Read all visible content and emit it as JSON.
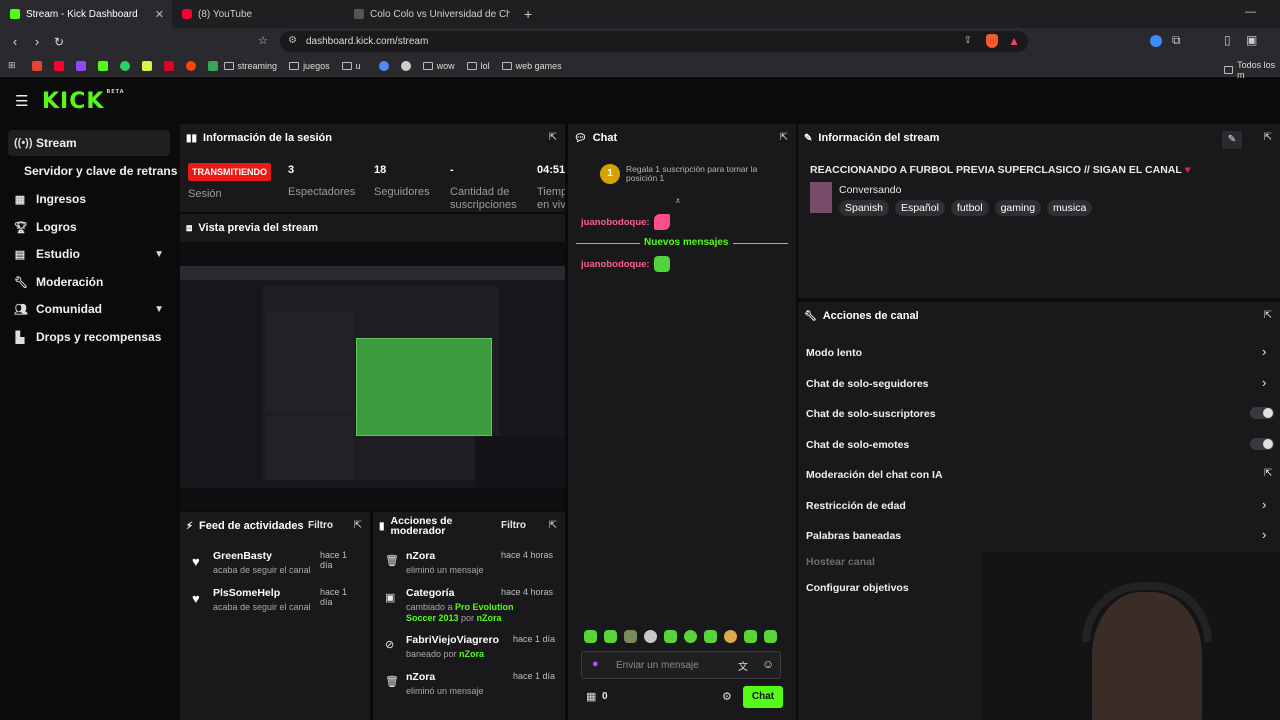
{
  "browser": {
    "tabs": [
      {
        "title": "Stream - Kick Dashboard",
        "color": "#53fc18"
      },
      {
        "title": "(8) YouTube",
        "color": "#ff0033"
      },
      {
        "title": "Colo Colo vs Universidad de Chile Al",
        "color": "#444444"
      }
    ],
    "new_tab": "+",
    "url": "dashboard.kick.com/stream",
    "bookmarks": {
      "folders": [
        "streaming",
        "juegos",
        "u",
        "wow",
        "lol",
        "web games"
      ],
      "right_folder": "Todos los m"
    }
  },
  "app": {
    "logo": "KICK",
    "logo_badge": "BETA",
    "accent": "#53fc18",
    "sidebar": [
      {
        "label": "Stream",
        "icon": "broadcast-icon"
      },
      {
        "label": "Servidor y clave de retransmisión",
        "icon": ""
      },
      {
        "label": "Ingresos",
        "icon": "money-icon"
      },
      {
        "label": "Logros",
        "icon": "trophy-icon"
      },
      {
        "label": "Estudio",
        "icon": "studio-icon"
      },
      {
        "label": "Moderación",
        "icon": "wrench-icon"
      },
      {
        "label": "Comunidad",
        "icon": "community-icon"
      },
      {
        "label": "Drops y recompensas",
        "icon": "drops-icon"
      }
    ]
  },
  "session": {
    "title": "Información de la sesión",
    "status": "TRANSMITIENDO",
    "status_label": "Sesión",
    "stats": [
      {
        "value": "3",
        "label": "Espectadores"
      },
      {
        "value": "18",
        "label": "Seguidores"
      },
      {
        "value": "-",
        "label": "Cantidad de suscripciones"
      },
      {
        "value": "04:51",
        "label": "Tiempo en vivo"
      }
    ]
  },
  "preview": {
    "title": "Vista previa del stream"
  },
  "feed": {
    "title": "Feed de actividades",
    "filter": "Filtro",
    "items": [
      {
        "name": "GreenBasty",
        "text": "acaba de seguir el canal",
        "time": "hace 1 día"
      },
      {
        "name": "PlsSomeHelp",
        "text": "acaba de seguir el canal",
        "time": "hace 1 día"
      }
    ]
  },
  "mod_actions": {
    "title": "Acciones de moderador",
    "filter": "Filtro",
    "items": [
      {
        "name": "nZora",
        "line1": "eliminó un mensaje",
        "time": "hace 4 horas"
      },
      {
        "name": "Categoría",
        "pre": "cambiado a ",
        "highlight": "Pro Evolution Soccer 2013",
        "mid": " por ",
        "by": "nZora",
        "time": "hace 4 horas"
      },
      {
        "name": "FabriViejoViagrero",
        "pre": "baneado por ",
        "by": "nZora",
        "time": "hace 1 día"
      },
      {
        "name": "nZora",
        "line1": "eliminó un mensaje",
        "time": "hace 1 día"
      }
    ]
  },
  "chat": {
    "title": "Chat",
    "gift_rank": "1",
    "gift_text": "Regala 1 suscripción para tomar la posición 1",
    "divider": "Nuevos mensajes",
    "messages": [
      {
        "user": "juanobodoque:"
      },
      {
        "user": "juanobodoque:"
      }
    ],
    "input_placeholder": "Enviar un mensaje",
    "points": "0",
    "send_label": "Chat"
  },
  "stream_info": {
    "title": "Información del stream",
    "stream_title": "REACCIONANDO A FURBOL PREVIA SUPERCLASICO // SIGAN EL CANAL",
    "category": "Conversando",
    "tags": [
      "Spanish",
      "Español",
      "futbol",
      "gaming",
      "musica"
    ]
  },
  "channel_actions": {
    "title": "Acciones de canal",
    "rows": [
      {
        "label": "Modo lento",
        "control": "chevron"
      },
      {
        "label": "Chat de solo-seguidores",
        "control": "chevron"
      },
      {
        "label": "Chat de solo-suscriptores",
        "control": "toggle"
      },
      {
        "label": "Chat de solo-emotes",
        "control": "toggle"
      },
      {
        "label": "Moderación del chat con IA",
        "control": "external"
      },
      {
        "label": "Restricción de edad",
        "control": "chevron"
      },
      {
        "label": "Palabras baneadas",
        "control": "chevron"
      },
      {
        "label": "Hostear canal",
        "control": "none"
      },
      {
        "label": "Configurar objetivos",
        "control": "none"
      }
    ]
  }
}
